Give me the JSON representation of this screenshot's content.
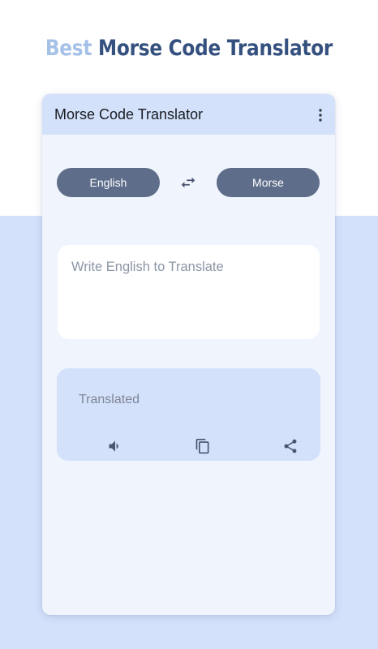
{
  "promo": {
    "accent_word": "Best",
    "headline": "Morse Code Translator"
  },
  "appbar": {
    "title": "Morse Code Translator",
    "menu_icon": "more-vert-icon"
  },
  "languages": {
    "source": "English",
    "target": "Morse",
    "swap_icon": "swap-horiz-icon"
  },
  "input": {
    "placeholder": "Write English to Translate",
    "value": ""
  },
  "output": {
    "text": "Translated",
    "actions": [
      "volume-icon",
      "copy-icon",
      "share-icon"
    ]
  },
  "colors": {
    "accent_light": "#a6c1e8",
    "accent_dark": "#34507e",
    "pill": "#5e6d8a",
    "surface_tint": "#d3e1fb",
    "surface": "#f0f4fc"
  }
}
